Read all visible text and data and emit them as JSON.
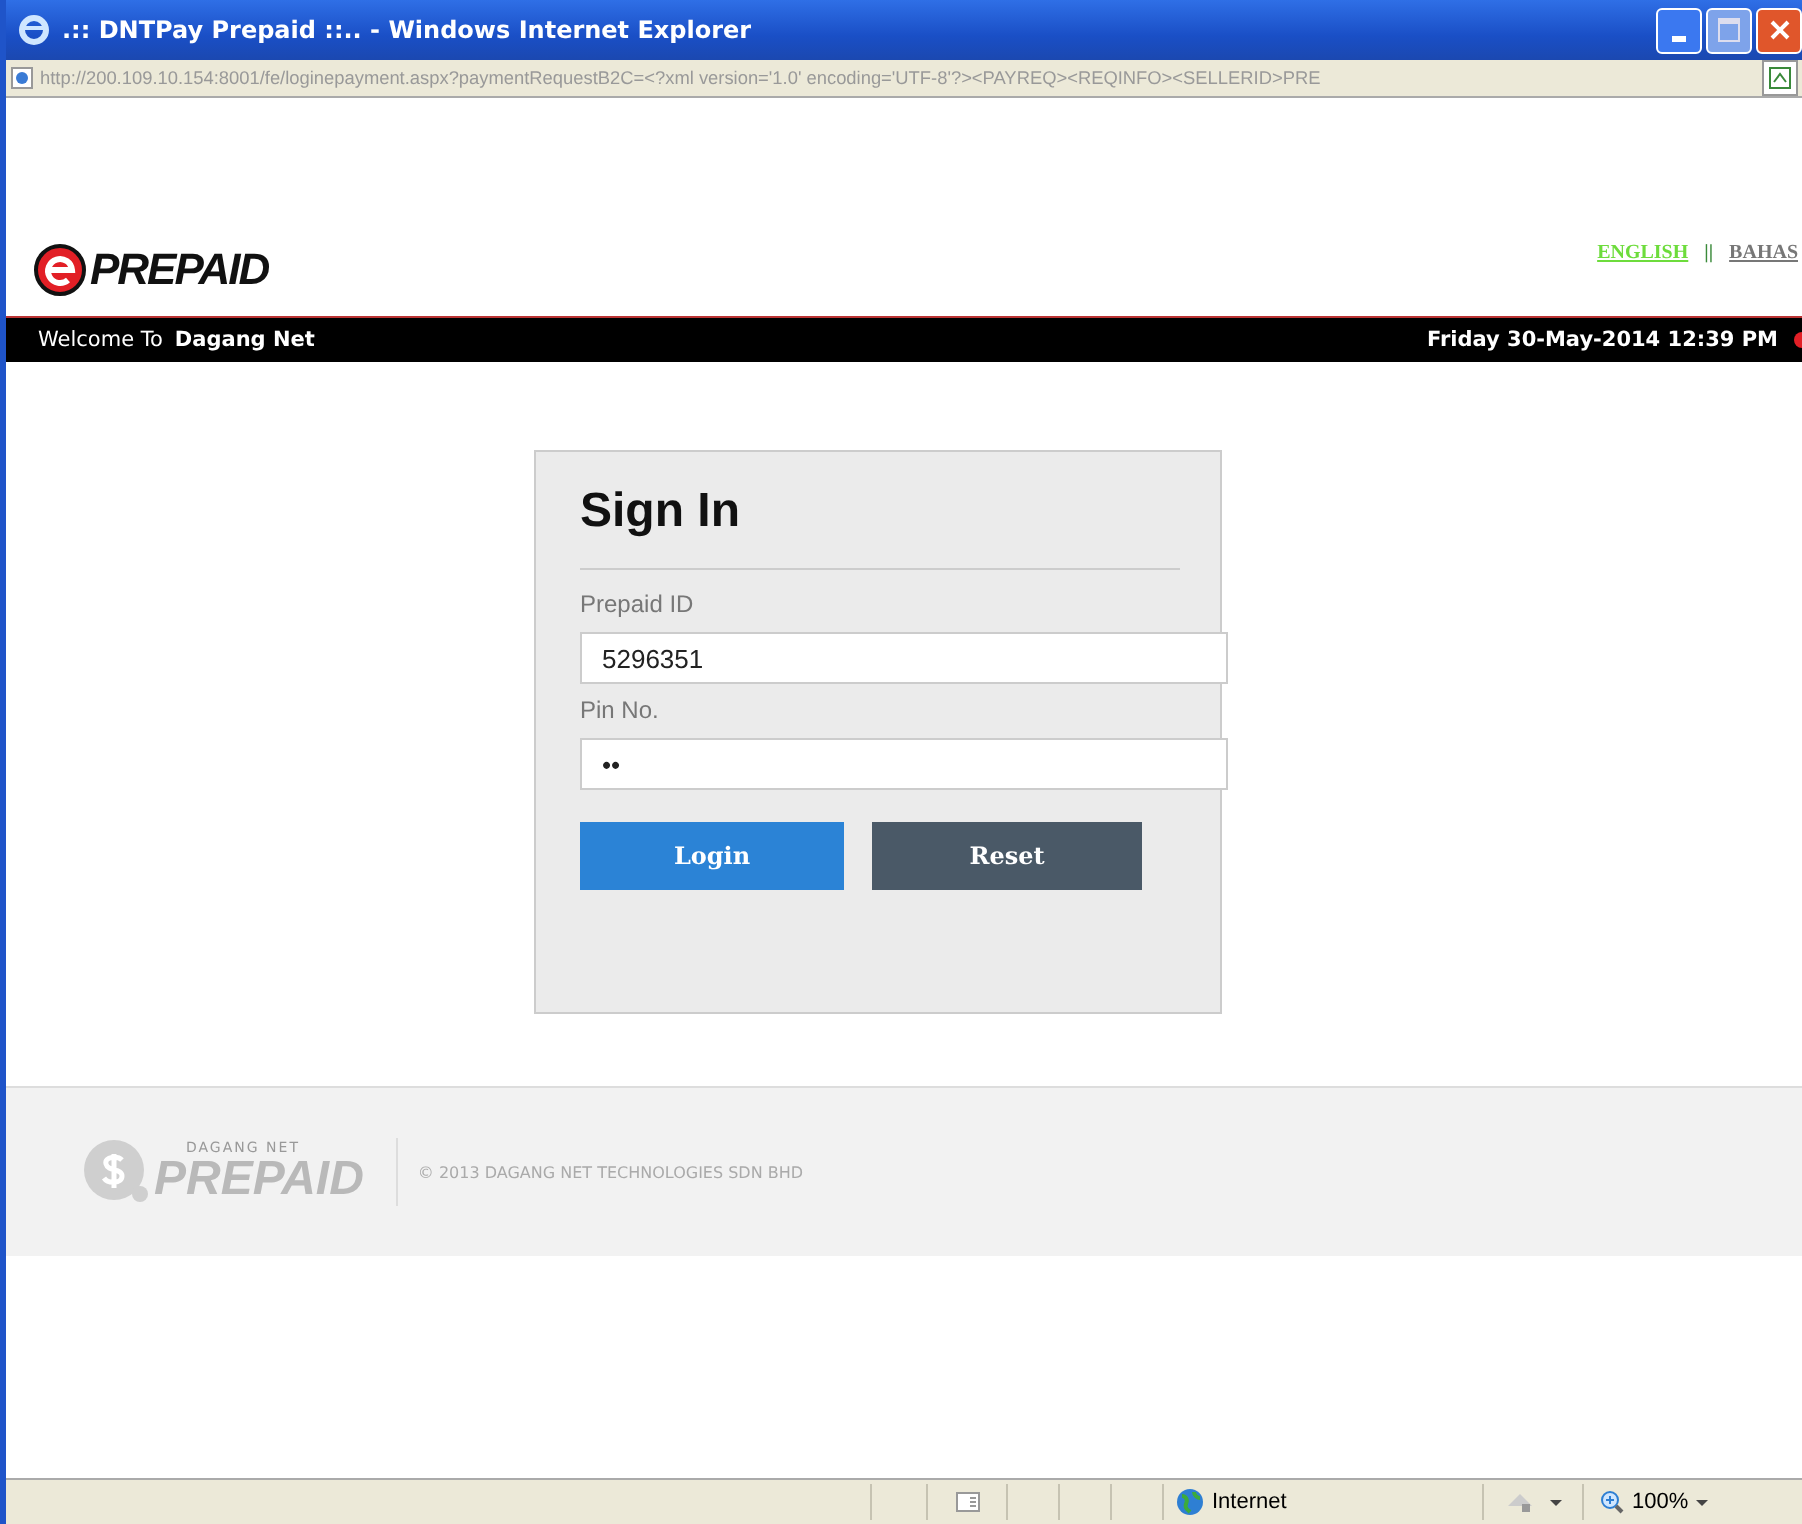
{
  "window": {
    "title": ".:: DNTPay Prepaid ::.. - Windows Internet Explorer"
  },
  "address_bar": {
    "url": "http://200.109.10.154:8001/fe/loginepayment.aspx?paymentRequestB2C=<?xml version='1.0' encoding='UTF-8'?><PAYREQ><REQINFO><SELLERID>PRE"
  },
  "header": {
    "logo": "PREPAID",
    "languages": [
      {
        "label": "ENGLISH",
        "selected": true
      },
      {
        "label": "BAHAS",
        "selected": false
      }
    ],
    "separator": "||"
  },
  "welcome_bar": {
    "label": "Welcome To",
    "name": "Dagang Net",
    "datetime": "Friday 30-May-2014 12:39 PM"
  },
  "sign_in": {
    "title": "Sign In",
    "fields": [
      {
        "label": "Prepaid ID",
        "value": "5296351"
      },
      {
        "label": "Pin No.",
        "value": "••"
      }
    ],
    "buttons": [
      {
        "label": "Login",
        "kind": "primary"
      },
      {
        "label": "Reset",
        "kind": "secondary"
      }
    ]
  },
  "footer": {
    "logo_small": "DAGANG NET",
    "logo": "PREPAID",
    "copyright": "© 2013 DAGANG NET TECHNOLOGIES SDN BHD"
  },
  "status_bar": {
    "zone": "Internet",
    "zoom": "100%"
  }
}
